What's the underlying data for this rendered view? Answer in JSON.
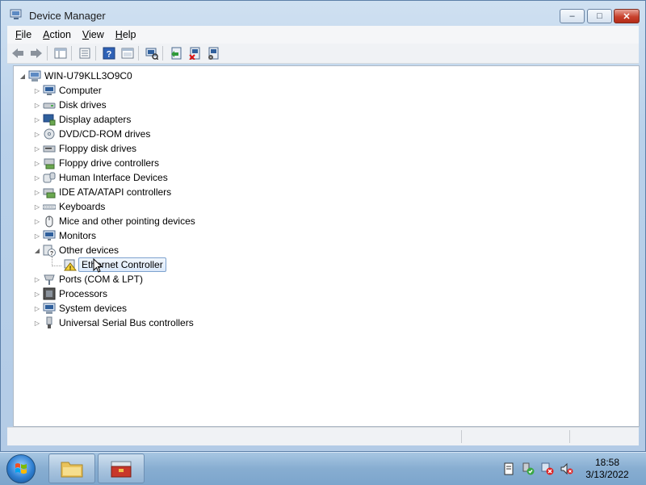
{
  "window": {
    "title": "Device Manager",
    "controls": {
      "minimize": "–",
      "maximize": "□",
      "close": "✕"
    }
  },
  "menu": [
    {
      "label": "File",
      "accel": "F",
      "rest": "ile"
    },
    {
      "label": "Action",
      "accel": "A",
      "rest": "ction"
    },
    {
      "label": "View",
      "accel": "V",
      "rest": "iew"
    },
    {
      "label": "Help",
      "accel": "H",
      "rest": "elp"
    }
  ],
  "toolbar": {
    "icons": [
      "back-icon",
      "forward-icon",
      "show-hide-console-tree-icon",
      "properties-icon",
      "help-icon",
      "view-icon",
      "scan-hardware-icon",
      "update-driver-icon",
      "uninstall-icon",
      "disable-icon"
    ]
  },
  "tree": {
    "root": "WIN-U79KLL3O9C0",
    "categories": [
      {
        "label": "Computer",
        "icon": "computer-icon"
      },
      {
        "label": "Disk drives",
        "icon": "disk-drive-icon"
      },
      {
        "label": "Display adapters",
        "icon": "display-adapter-icon"
      },
      {
        "label": "DVD/CD-ROM drives",
        "icon": "dvd-drive-icon"
      },
      {
        "label": "Floppy disk drives",
        "icon": "floppy-drive-icon"
      },
      {
        "label": "Floppy drive controllers",
        "icon": "floppy-controller-icon"
      },
      {
        "label": "Human Interface Devices",
        "icon": "hid-icon"
      },
      {
        "label": "IDE ATA/ATAPI controllers",
        "icon": "ide-controller-icon"
      },
      {
        "label": "Keyboards",
        "icon": "keyboard-icon"
      },
      {
        "label": "Mice and other pointing devices",
        "icon": "mouse-icon"
      },
      {
        "label": "Monitors",
        "icon": "monitor-icon"
      },
      {
        "label": "Other devices",
        "icon": "unknown-device-icon",
        "expanded": true,
        "children": [
          {
            "label": "Ethernet Controller",
            "icon": "warning-device-icon",
            "selected": true
          }
        ]
      },
      {
        "label": "Ports (COM & LPT)",
        "icon": "port-icon"
      },
      {
        "label": "Processors",
        "icon": "processor-icon"
      },
      {
        "label": "System devices",
        "icon": "system-device-icon"
      },
      {
        "label": "Universal Serial Bus controllers",
        "icon": "usb-icon"
      }
    ]
  },
  "taskbar": {
    "clock_time": "18:58",
    "clock_date": "3/13/2022",
    "tray_icons": [
      "action-center-icon",
      "safely-remove-hardware-icon",
      "network-error-icon",
      "volume-muted-icon"
    ]
  },
  "colors": {
    "selection_border": "#7da2ce",
    "window_frame": "#b9d1ea",
    "close_button": "#c8412d"
  }
}
